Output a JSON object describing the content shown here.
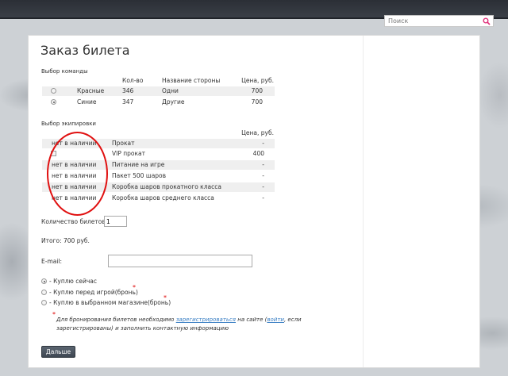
{
  "search": {
    "placeholder": "Поиск"
  },
  "page": {
    "title": "Заказ билета"
  },
  "team": {
    "section_label": "Выбор команды",
    "headers": {
      "qty": "Кол-во",
      "side": "Название стороны",
      "price": "Цена, руб."
    },
    "rows": [
      {
        "name": "Красные",
        "qty": "346",
        "side": "Одни",
        "price": "700",
        "selected": false
      },
      {
        "name": "Синие",
        "qty": "347",
        "side": "Другие",
        "price": "700",
        "selected": true
      }
    ]
  },
  "equipment": {
    "section_label": "Выбор экипировки",
    "price_header": "Цена, руб.",
    "rows": [
      {
        "status": "нет в наличии",
        "name": "Прокат",
        "price": "-"
      },
      {
        "status": "",
        "name": "VIP прокат",
        "price": "400"
      },
      {
        "status": "нет в наличии",
        "name": "Питание на игре",
        "price": "-"
      },
      {
        "status": "нет в наличии",
        "name": "Пакет 500 шаров",
        "price": "-"
      },
      {
        "status": "нет в наличии",
        "name": "Коробка шаров прокатного класса",
        "price": "-"
      },
      {
        "status": "нет в наличии",
        "name": "Коробка шаров среднего класса",
        "price": "-"
      }
    ]
  },
  "tickets": {
    "label": "Количество билетов:",
    "value": "1"
  },
  "total": {
    "text": "Итого: 700 руб."
  },
  "email": {
    "label": "E-mail:",
    "value": ""
  },
  "purchase_options": [
    {
      "label": "- Куплю сейчас",
      "selected": true,
      "required": false
    },
    {
      "label": "- Куплю перед игрой(бронь)",
      "selected": false,
      "required": true
    },
    {
      "label": "- Куплю в выбранном магазине(бронь)",
      "selected": false,
      "required": true
    }
  ],
  "note": {
    "star": "*",
    "part1": "Для бронирования билетов необходимо ",
    "link_register": "зарегистрироваться",
    "part2": " на сайте (",
    "link_login": "войти",
    "part3": ", если зарегистрированы) и заполнить контактную информацию"
  },
  "submit": {
    "label": "Дальше"
  },
  "colors": {
    "accent_star": "#dd0000",
    "annotation": "#e01010",
    "link": "#3a7fc4"
  }
}
